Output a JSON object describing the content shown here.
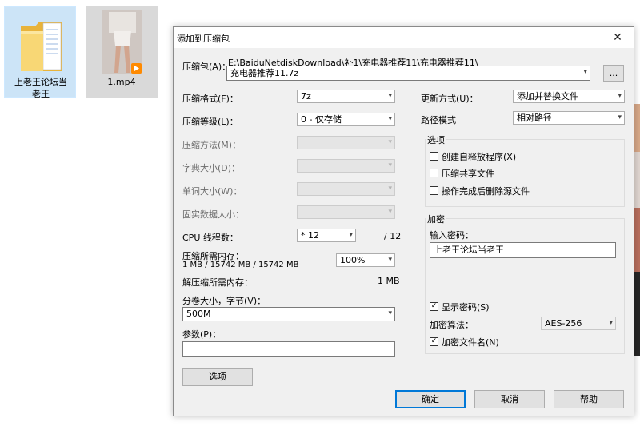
{
  "desktop": {
    "folder_label": "上老王论坛当老王",
    "video_label": "1.mp4"
  },
  "dialog": {
    "title": "添加到压缩包",
    "close_glyph": "✕",
    "archive_label": "压缩包(A)：",
    "archive_path": "E:\\BaiduNetdiskDownload\\补1\\充电器推荐11\\充电器推荐11\\",
    "archive_name": "充电器推荐11.7z",
    "browse_label": "...",
    "format_label": "压缩格式(F)：",
    "format_value": "7z",
    "level_label": "压缩等级(L)：",
    "level_value": "0 - 仅存储",
    "method_label": "压缩方法(M)：",
    "dict_label": "字典大小(D)：",
    "word_label": "单词大小(W)：",
    "solid_label": "固实数据大小：",
    "cpu_label": "CPU 线程数：",
    "cpu_value": "* 12",
    "cpu_total": "/ 12",
    "mem_label": "压缩所需内存：",
    "mem_value": "1 MB / 15742 MB / 15742 MB",
    "mem_percent": "100%",
    "decomp_label": "解压缩所需内存：",
    "decomp_value": "1 MB",
    "split_label": "分卷大小，字节(V)：",
    "split_value": "500M",
    "params_label": "参数(P)：",
    "params_value": "",
    "options_button": "选项",
    "update_label": "更新方式(U)：",
    "update_value": "添加并替换文件",
    "path_label": "路径模式",
    "path_value": "相对路径",
    "options_group": "选项",
    "opt_sfx": "创建自释放程序(X)",
    "opt_shared": "压缩共享文件",
    "opt_delete": "操作完成后删除源文件",
    "enc_group": "加密",
    "password_label": "输入密码：",
    "password_value": "上老王论坛当老王",
    "show_password": "显示密码(S)",
    "enc_method_label": "加密算法：",
    "enc_method_value": "AES-256",
    "enc_names": "加密文件名(N)",
    "ok": "确定",
    "cancel": "取消",
    "help": "帮助",
    "dropdown_arrow": "▾",
    "check_glyph": "✓"
  }
}
